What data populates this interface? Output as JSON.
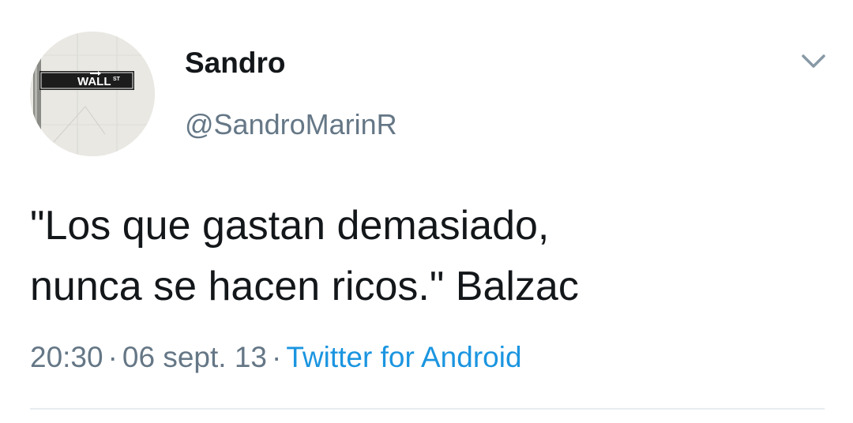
{
  "user": {
    "display_name": "Sandro",
    "handle": "@SandroMarinR",
    "avatar_sign_text": "WALL",
    "avatar_sign_suffix": "ST"
  },
  "tweet": {
    "text_lines": [
      "\"Los que gastan demasiado,",
      "nunca se hacen ricos.\" Balzac"
    ],
    "time": "20:30",
    "date": "06 sept. 13",
    "separator": "·",
    "source": "Twitter for Android"
  },
  "icons": {
    "menu": "chevron-down-icon"
  },
  "colors": {
    "text": "#14171a",
    "secondary": "#657786",
    "link": "#1b95e0",
    "divider": "#e6ecf0"
  }
}
